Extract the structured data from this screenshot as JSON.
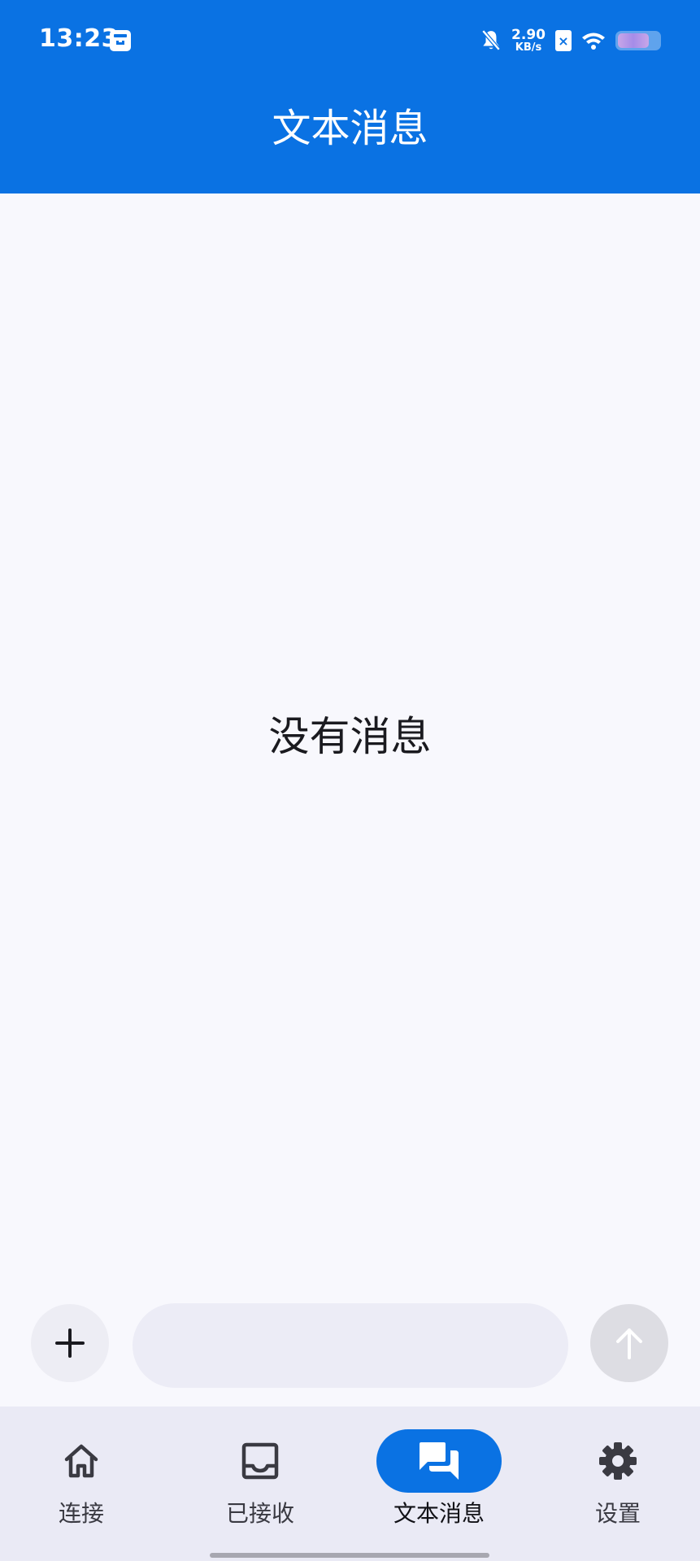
{
  "status_bar": {
    "time": "13:23",
    "net_speed_value": "2.90",
    "net_speed_unit": "KB/s",
    "sim_mark": "×"
  },
  "header": {
    "title": "文本消息"
  },
  "main": {
    "empty_text": "没有消息"
  },
  "composer": {
    "input_value": "",
    "input_placeholder": ""
  },
  "nav": {
    "items": [
      {
        "label": "连接",
        "icon": "home-icon",
        "active": false
      },
      {
        "label": "已接收",
        "icon": "inbox-icon",
        "active": false
      },
      {
        "label": "文本消息",
        "icon": "chat-icon",
        "active": true
      },
      {
        "label": "设置",
        "icon": "gear-icon",
        "active": false
      }
    ]
  },
  "colors": {
    "primary": "#0A72E3",
    "background": "#F8F8FD",
    "nav_background": "#EAEAF5",
    "input_background": "#ECECF6",
    "send_disabled": "#DDDDE3"
  }
}
